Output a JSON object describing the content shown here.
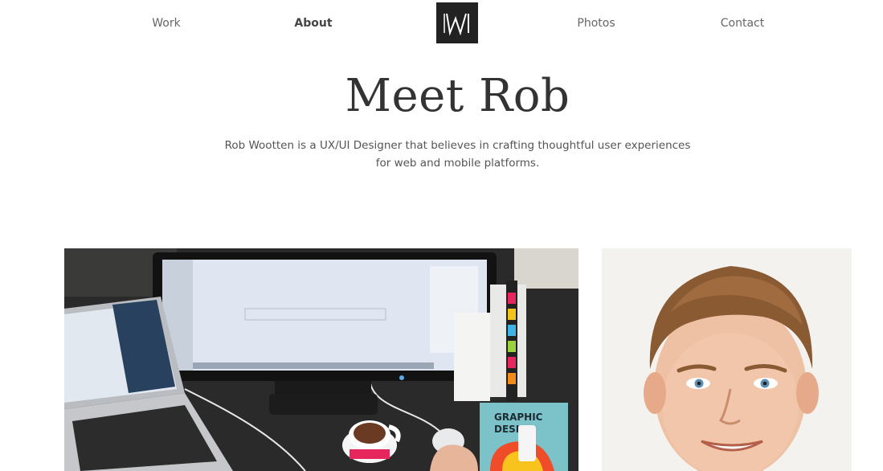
{
  "nav": {
    "items": [
      {
        "label": "Work",
        "active": false
      },
      {
        "label": "About",
        "active": true
      },
      {
        "label": "Photos",
        "active": false
      },
      {
        "label": "Contact",
        "active": false
      }
    ],
    "logo_icon": "w-monogram-logo-icon"
  },
  "hero": {
    "title": "Meet Rob",
    "description": "Rob Wootten is a UX/UI Designer that believes in crafting thoughtful user experiences for web and mobile platforms."
  },
  "photos": {
    "desk": {
      "book_title_line1": "GRAPHIC",
      "book_title_line2": "DESI"
    }
  },
  "colors": {
    "logo_bg": "#222222",
    "text_dark": "#333333",
    "text_muted": "#666666"
  }
}
